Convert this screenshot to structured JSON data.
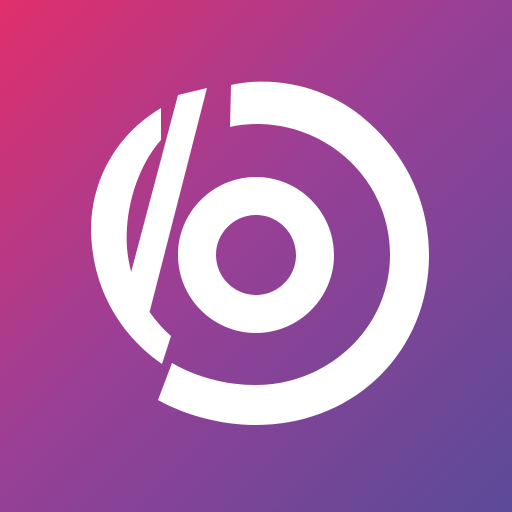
{
  "app_icon": {
    "icon": "circular-b-logo-icon",
    "colors": {
      "gradient_start": "#e12f6b",
      "gradient_mid": "#9a3f96",
      "gradient_end": "#5a4b98",
      "logo": "#ffffff"
    }
  }
}
